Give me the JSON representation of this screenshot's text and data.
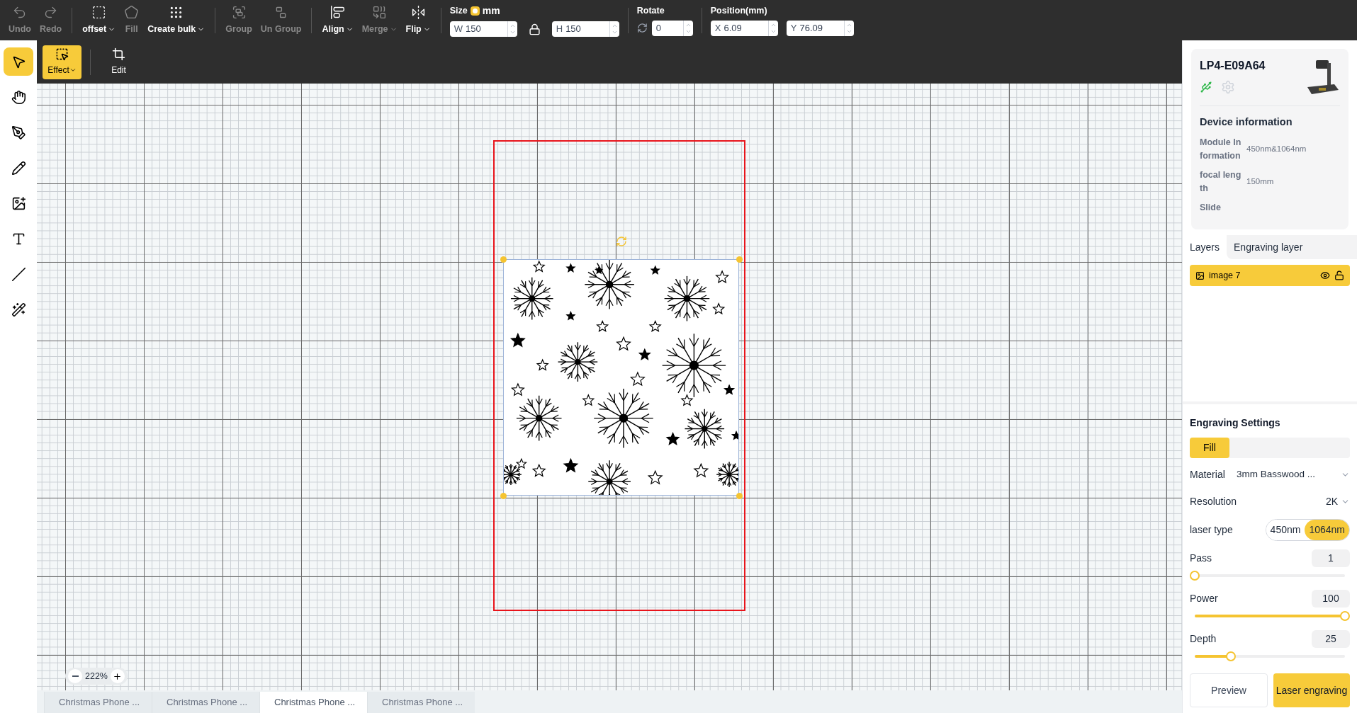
{
  "toolbar": {
    "items": [
      {
        "label": "Undo",
        "disabled": true,
        "dropdown": false
      },
      {
        "label": "Redo",
        "disabled": true,
        "dropdown": false
      },
      {
        "label": "offset",
        "disabled": false,
        "dropdown": true
      },
      {
        "label": "Fill",
        "disabled": true,
        "dropdown": false
      },
      {
        "label": "Create bulk",
        "disabled": false,
        "dropdown": true
      },
      {
        "label": "Group",
        "disabled": true,
        "dropdown": false
      },
      {
        "label": "Un Group",
        "disabled": true,
        "dropdown": false
      },
      {
        "label": "Align",
        "disabled": false,
        "dropdown": true
      },
      {
        "label": "Merge",
        "disabled": true,
        "dropdown": true
      },
      {
        "label": "Flip",
        "disabled": false,
        "dropdown": true
      }
    ],
    "size": {
      "label": "Size",
      "unit": "mm",
      "unit_checked": true,
      "width": {
        "prefix": "W",
        "value": "150"
      },
      "height": {
        "prefix": "H",
        "value": "150"
      }
    },
    "rotate": {
      "label": "Rotate",
      "value": "0"
    },
    "position": {
      "label": "Position(mm)",
      "x": {
        "prefix": "X",
        "value": "6.09"
      },
      "y": {
        "prefix": "Y",
        "value": "76.09"
      }
    }
  },
  "secondary_toolbar": [
    {
      "label": "Effect",
      "selected": true,
      "dropdown": true
    },
    {
      "label": "Edit",
      "selected": false,
      "dropdown": false
    }
  ],
  "left_tools": [
    {
      "selected": true
    },
    {
      "selected": false
    },
    {
      "selected": false
    },
    {
      "selected": false
    },
    {
      "selected": false
    },
    {
      "selected": false
    },
    {
      "selected": false
    },
    {
      "selected": false
    }
  ],
  "canvas": {
    "zoom": "222%"
  },
  "file_tabs": [
    {
      "label": "Christmas Phone ...",
      "selected": false
    },
    {
      "label": "Christmas Phone ...",
      "selected": false
    },
    {
      "label": "Christmas Phone ...",
      "selected": true
    },
    {
      "label": "Christmas Phone ...",
      "selected": false
    }
  ],
  "device": {
    "name": "LP4-E09A64",
    "info_title": "Device information",
    "info": [
      {
        "label": "Module Information",
        "value": "450nm&1064nm"
      },
      {
        "label": "focal length",
        "value": "150mm"
      },
      {
        "label": "Slide"
      }
    ]
  },
  "layer_tabs": [
    {
      "label": "Layers",
      "selected": true
    },
    {
      "label": "Engraving layer",
      "selected": false
    }
  ],
  "layers": [
    {
      "name": "image 7",
      "selected": true,
      "visible": true,
      "locked": false
    }
  ],
  "engraving": {
    "title": "Engraving Settings",
    "modes": [
      {
        "label": "Fill",
        "selected": true
      }
    ],
    "material": {
      "label": "Material",
      "value": "3mm Basswood ..."
    },
    "resolution": {
      "label": "Resolution",
      "value": "2K"
    },
    "laser_type": {
      "label": "laser type",
      "options": [
        {
          "label": "450nm",
          "selected": false
        },
        {
          "label": "1064nm",
          "selected": true
        }
      ]
    },
    "sliders": [
      {
        "label": "Pass",
        "value": "1",
        "level": 0
      },
      {
        "label": "Power",
        "value": "100",
        "level": 1
      },
      {
        "label": "Depth",
        "value": "25",
        "level": 0.24
      }
    ],
    "buttons": [
      {
        "label": "Preview",
        "kind": "secondary"
      },
      {
        "label": "Laser engraving",
        "kind": "primary"
      }
    ]
  }
}
